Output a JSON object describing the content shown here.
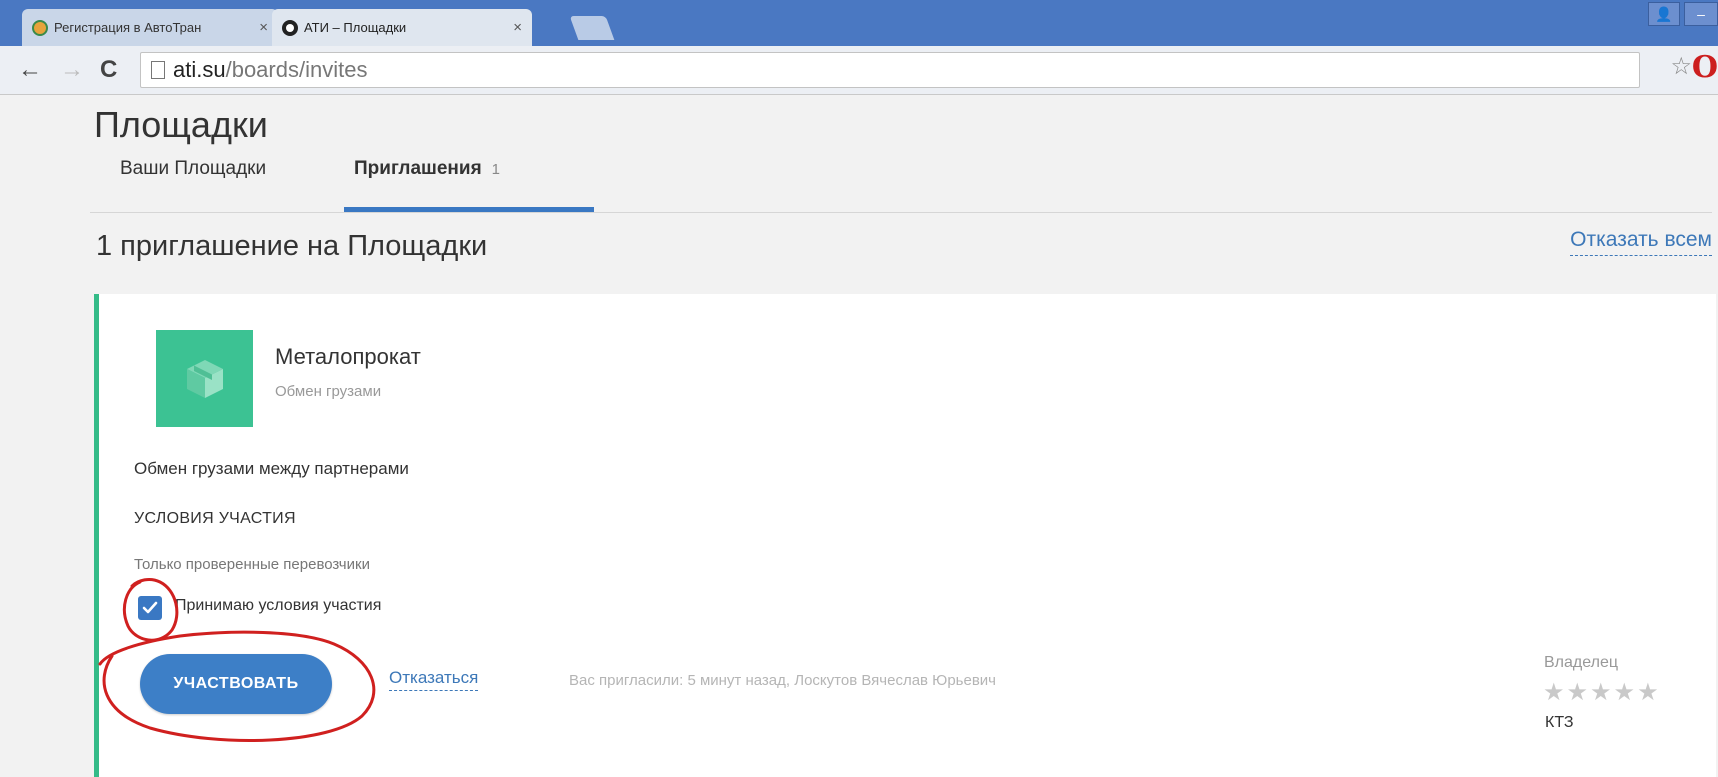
{
  "browser": {
    "tabs": [
      {
        "title": "Регистрация в АвтоТран",
        "close": "×",
        "active": false
      },
      {
        "title": "АТИ – Площадки",
        "close": "×",
        "active": true
      }
    ],
    "window_buttons": {
      "user": "👤",
      "minimize": "–"
    },
    "nav": {
      "back": "←",
      "forward": "→",
      "reload": "C"
    },
    "address": {
      "host": "ati.su",
      "path": "/boards/invites"
    },
    "star_icon": "☆",
    "extension_icon": "O"
  },
  "page": {
    "title": "Площадки",
    "tabs": [
      {
        "label": "Ваши Площадки",
        "count": ""
      },
      {
        "label": "Приглашения",
        "count": "1"
      }
    ],
    "invites_heading": "1 приглашение на Площадки",
    "reject_all": "Отказать всем"
  },
  "invite": {
    "board_name": "Металопрокат",
    "board_type": "Обмен грузами",
    "description": "Обмен грузами между партнерами",
    "conditions_title": "УСЛОВИЯ УЧАСТИЯ",
    "conditions_text": "Только проверенные перевозчики",
    "accept_label": "Принимаю условия участия",
    "accept_checked": true,
    "join_button": "УЧАСТВОВАТЬ",
    "decline_link": "Отказаться",
    "invited_info": "Вас пригласили: 5 минут назад, Лоскутов Вячеслав Юрьевич",
    "owner_label": "Владелец",
    "owner_stars": "★★★★★",
    "owner_rating": 0,
    "owner_name": "КТЗ"
  },
  "colors": {
    "accent": "#3d7fc7",
    "card_border": "#34bb88",
    "logo_bg": "#3cc293",
    "annotation": "#d0201f"
  }
}
